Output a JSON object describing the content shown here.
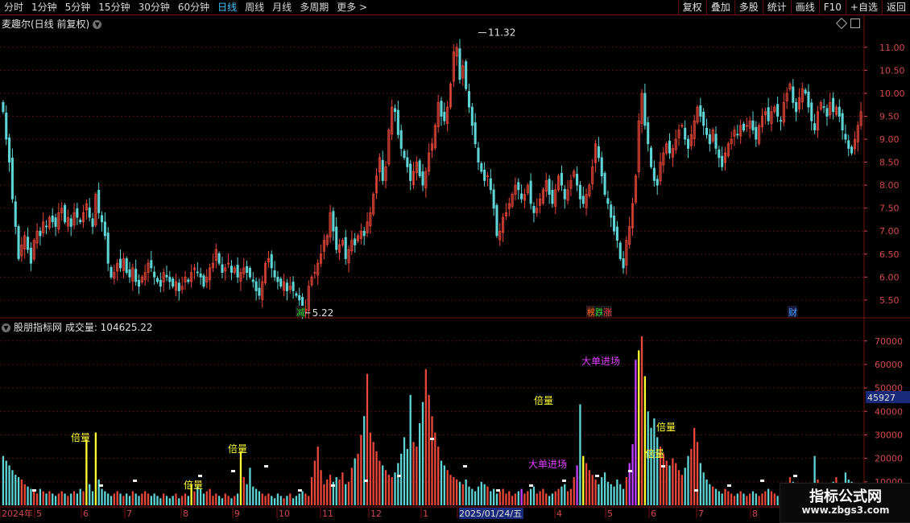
{
  "toolbar": {
    "periods": [
      "分时",
      "1分钟",
      "5分钟",
      "15分钟",
      "30分钟",
      "60分钟",
      "日线",
      "周线",
      "月线",
      "多周期",
      "更多 >"
    ],
    "active_period": "日线",
    "buttons": [
      "复权",
      "叠加",
      "多股",
      "统计",
      "画线",
      "F10",
      "+自选",
      "返回"
    ]
  },
  "main_chart": {
    "title": "麦趣尔(日线 前复权)",
    "high_label": "11.32",
    "low_label": "5.22",
    "price_axis": [
      "11.00",
      "10.50",
      "10.00",
      "9.50",
      "9.00",
      "8.50",
      "8.00",
      "7.50",
      "7.00",
      "6.50",
      "6.00",
      "5.50"
    ],
    "markers": [
      {
        "text": "减",
        "color": "#2bd12b",
        "bg": "#1a1a1a"
      },
      {
        "text": "榜",
        "color": "#ff6a00",
        "bg": "#3a1a1a"
      },
      {
        "text": "跌",
        "color": "#2bd12b",
        "bg": "#1a1a1a"
      },
      {
        "text": "涨",
        "color": "#ff3b3b",
        "bg": "#1a1a1a"
      },
      {
        "text": "财",
        "color": "#41a0ff",
        "bg": "#1a1a3a"
      }
    ]
  },
  "volume_chart": {
    "title": "股朋指标网  成交量: 104625.22",
    "axis": [
      "70000",
      "60000",
      "50000",
      "40000",
      "30000",
      "20000",
      "10000"
    ],
    "current_value": "45927",
    "labels": {
      "double": "倍量",
      "big": "大单进场"
    }
  },
  "date_axis": {
    "labels": [
      "2024年",
      "5",
      "6",
      "7",
      "8",
      "9",
      "10",
      "11",
      "12",
      "1",
      "2025/01/24/五",
      "4",
      "5",
      "6",
      "7",
      "8"
    ]
  },
  "watermark": {
    "title": "指标公式网",
    "url": "www.zbgs3.com"
  },
  "colors": {
    "up": "#e8473a",
    "down": "#5fd4d4",
    "accent": "#41c5ff",
    "axis": "#d24a4a",
    "double_vol": "#ffff33",
    "big_vol": "#c040ff"
  },
  "chart_data": {
    "type": "candlestick",
    "price_range": [
      5.2,
      11.4
    ],
    "volume_range": [
      0,
      73000
    ],
    "extreme_high": 11.32,
    "extreme_low": 5.22,
    "closes": [
      9.6,
      9.0,
      8.5,
      7.7,
      7.1,
      6.4,
      6.7,
      6.9,
      6.6,
      6.3,
      6.8,
      7.0,
      6.9,
      7.2,
      7.1,
      7.3,
      7.2,
      7.1,
      7.4,
      7.5,
      7.2,
      7.3,
      7.1,
      7.4,
      7.3,
      7.2,
      7.4,
      7.6,
      7.3,
      7.1,
      7.8,
      7.4,
      7.2,
      6.9,
      6.3,
      6.0,
      6.1,
      6.3,
      6.2,
      6.4,
      6.1,
      6.0,
      6.2,
      5.9,
      5.8,
      6.0,
      6.1,
      6.3,
      6.2,
      6.0,
      5.9,
      5.8,
      6.1,
      6.0,
      5.9,
      5.8,
      5.9,
      5.7,
      5.8,
      6.0,
      5.9,
      6.1,
      6.2,
      6.1,
      6.0,
      5.8,
      6.0,
      6.2,
      6.3,
      6.6,
      6.3,
      6.1,
      6.2,
      6.3,
      6.1,
      6.2,
      6.0,
      6.1,
      6.2,
      6.1,
      6.0,
      5.9,
      5.7,
      5.6,
      5.9,
      6.3,
      6.4,
      6.2,
      6.0,
      5.9,
      5.8,
      5.9,
      5.7,
      5.8,
      5.7,
      5.6,
      5.5,
      5.3,
      5.3,
      5.8,
      6.0,
      6.1,
      6.3,
      6.5,
      6.8,
      6.9,
      7.4,
      7.0,
      6.6,
      6.7,
      6.8,
      6.4,
      6.6,
      6.8,
      6.7,
      6.9,
      7.0,
      6.9,
      7.2,
      7.4,
      7.8,
      8.2,
      8.6,
      8.1,
      8.4,
      9.2,
      9.7,
      9.6,
      9.1,
      8.8,
      8.6,
      8.4,
      8.1,
      8.3,
      8.5,
      8.2,
      8.0,
      8.3,
      8.7,
      8.9,
      9.3,
      9.8,
      9.5,
      9.4,
      9.7,
      10.2,
      10.9,
      11.0,
      10.3,
      10.6,
      10.1,
      9.7,
      9.3,
      8.9,
      8.5,
      8.3,
      8.1,
      8.2,
      7.9,
      7.5,
      6.9,
      7.0,
      7.3,
      7.4,
      7.6,
      7.8,
      8.0,
      7.9,
      7.7,
      7.8,
      8.0,
      7.6,
      7.4,
      7.5,
      7.7,
      7.9,
      8.1,
      7.8,
      7.6,
      7.9,
      8.2,
      8.0,
      7.7,
      7.9,
      8.1,
      8.3,
      8.0,
      7.7,
      7.6,
      7.8,
      8.0,
      8.4,
      8.9,
      8.6,
      8.2,
      7.8,
      7.6,
      7.3,
      7.0,
      6.8,
      6.4,
      6.2,
      6.8,
      7.1,
      7.6,
      8.2,
      9.4,
      10.0,
      9.3,
      8.9,
      8.4,
      8.1,
      8.0,
      8.5,
      8.7,
      8.9,
      8.7,
      8.8,
      9.0,
      9.2,
      9.3,
      9.0,
      8.8,
      9.1,
      9.4,
      9.7,
      9.5,
      9.3,
      9.1,
      8.9,
      9.2,
      8.8,
      8.6,
      8.4,
      8.7,
      8.9,
      9.0,
      9.2,
      9.1,
      9.3,
      9.2,
      9.3,
      9.4,
      9.2,
      9.0,
      9.3,
      9.5,
      9.6,
      9.4,
      9.6,
      9.7,
      9.5,
      9.4,
      9.8,
      10.0,
      10.2,
      9.8,
      9.6,
      9.9,
      10.1,
      10.0,
      9.7,
      9.4,
      9.2,
      9.6,
      9.8,
      9.7,
      9.5,
      9.8,
      9.6,
      9.7,
      9.5,
      9.2,
      9.0,
      8.8,
      8.7,
      9.0,
      9.3,
      9.6
    ],
    "volumes": [
      21,
      19,
      17,
      15,
      13,
      12,
      11,
      9,
      8,
      7,
      6,
      5,
      7,
      6,
      5,
      6,
      5,
      4,
      5,
      6,
      5,
      4,
      5,
      6,
      5,
      7,
      6,
      28,
      9,
      6,
      31,
      11,
      7,
      6,
      5,
      4,
      5,
      6,
      5,
      4,
      5,
      4,
      6,
      5,
      4,
      5,
      6,
      5,
      4,
      5,
      4,
      3,
      5,
      4,
      3,
      4,
      5,
      3,
      4,
      5,
      4,
      9,
      6,
      8,
      7,
      5,
      6,
      7,
      4,
      5,
      4,
      3,
      5,
      4,
      3,
      4,
      5,
      23,
      12,
      9,
      16,
      8,
      7,
      6,
      5,
      4,
      5,
      4,
      3,
      5,
      4,
      3,
      4,
      5,
      3,
      4,
      5,
      6,
      5,
      4,
      12,
      19,
      25,
      15,
      9,
      11,
      13,
      10,
      12,
      11,
      14,
      9,
      10,
      16,
      20,
      22,
      30,
      38,
      56,
      31,
      27,
      23,
      19,
      17,
      15,
      13,
      12,
      14,
      18,
      22,
      29,
      24,
      47,
      27,
      25,
      35,
      44,
      58,
      47,
      38,
      31,
      25,
      19,
      17,
      15,
      13,
      12,
      11,
      10,
      9,
      11,
      8,
      7,
      6,
      8,
      10,
      9,
      8,
      6,
      7,
      5,
      6,
      7,
      5,
      6,
      4,
      5,
      6,
      7,
      5,
      6,
      7,
      8,
      5,
      6,
      7,
      5,
      4,
      5,
      6,
      7,
      8,
      9,
      6,
      7,
      12,
      17,
      43,
      21,
      18,
      15,
      13,
      11,
      9,
      12,
      14,
      10,
      9,
      8,
      11,
      9,
      7,
      12,
      18,
      26,
      62,
      66,
      72,
      55,
      40,
      33,
      37,
      29,
      25,
      22,
      19,
      17,
      20,
      18,
      15,
      13,
      16,
      21,
      24,
      33,
      27,
      18,
      14,
      11,
      9,
      8,
      7,
      6,
      5,
      7,
      6,
      5,
      4,
      5,
      6,
      5,
      4,
      5,
      6,
      5,
      4,
      5,
      6,
      7,
      6,
      5,
      4,
      5,
      6,
      9,
      12,
      10,
      7,
      6,
      5,
      4,
      5,
      7,
      21,
      11,
      8,
      9,
      6,
      7,
      10,
      12,
      9,
      8,
      14,
      11,
      10,
      8,
      7,
      9,
      6,
      7,
      8,
      6,
      5,
      4,
      5,
      6,
      7,
      11
    ],
    "double_volume_indices": [
      27,
      30,
      77,
      61,
      188,
      206,
      208
    ],
    "big_volume_indices": [
      168,
      186,
      203,
      204,
      205
    ]
  }
}
